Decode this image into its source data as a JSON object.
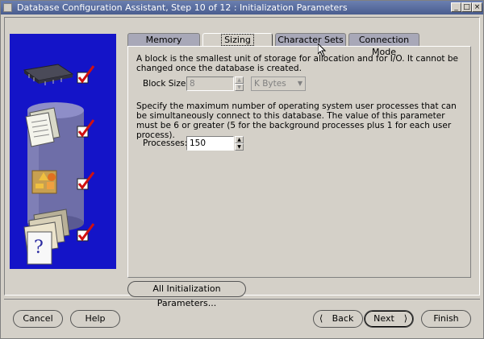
{
  "window": {
    "title": "Database Configuration Assistant, Step 10 of 12 : Initialization Parameters",
    "controls": [
      "_",
      "□",
      "×"
    ]
  },
  "tabs": [
    {
      "label": "Memory",
      "active": false
    },
    {
      "label": "Sizing",
      "active": true
    },
    {
      "label": "Character Sets",
      "active": false
    },
    {
      "label": "Connection Mode",
      "active": false
    }
  ],
  "sizing": {
    "block_description": "A block is the smallest unit of storage for allocation and for I/O. It cannot be changed once the database is created.",
    "block_size_label": "Block Size:",
    "block_size_value": "8",
    "block_size_unit": "K Bytes",
    "processes_description": "Specify the maximum number of operating system user processes that can be simultaneously connect to this database. The value of this parameter must be 6 or greater (5 for the background processes plus 1 for each user process).",
    "processes_label": "Processes:",
    "processes_value": "150"
  },
  "all_params_button": "All Initialization Parameters...",
  "footer": {
    "cancel": "Cancel",
    "help": "Help",
    "back": "Back",
    "next": "Next",
    "finish": "Finish"
  },
  "colors": {
    "titlebar": "#4a5d8f",
    "graphic_bg": "#1414c8",
    "checkmark": "#d01010",
    "window_bg": "#d4d0c8"
  }
}
